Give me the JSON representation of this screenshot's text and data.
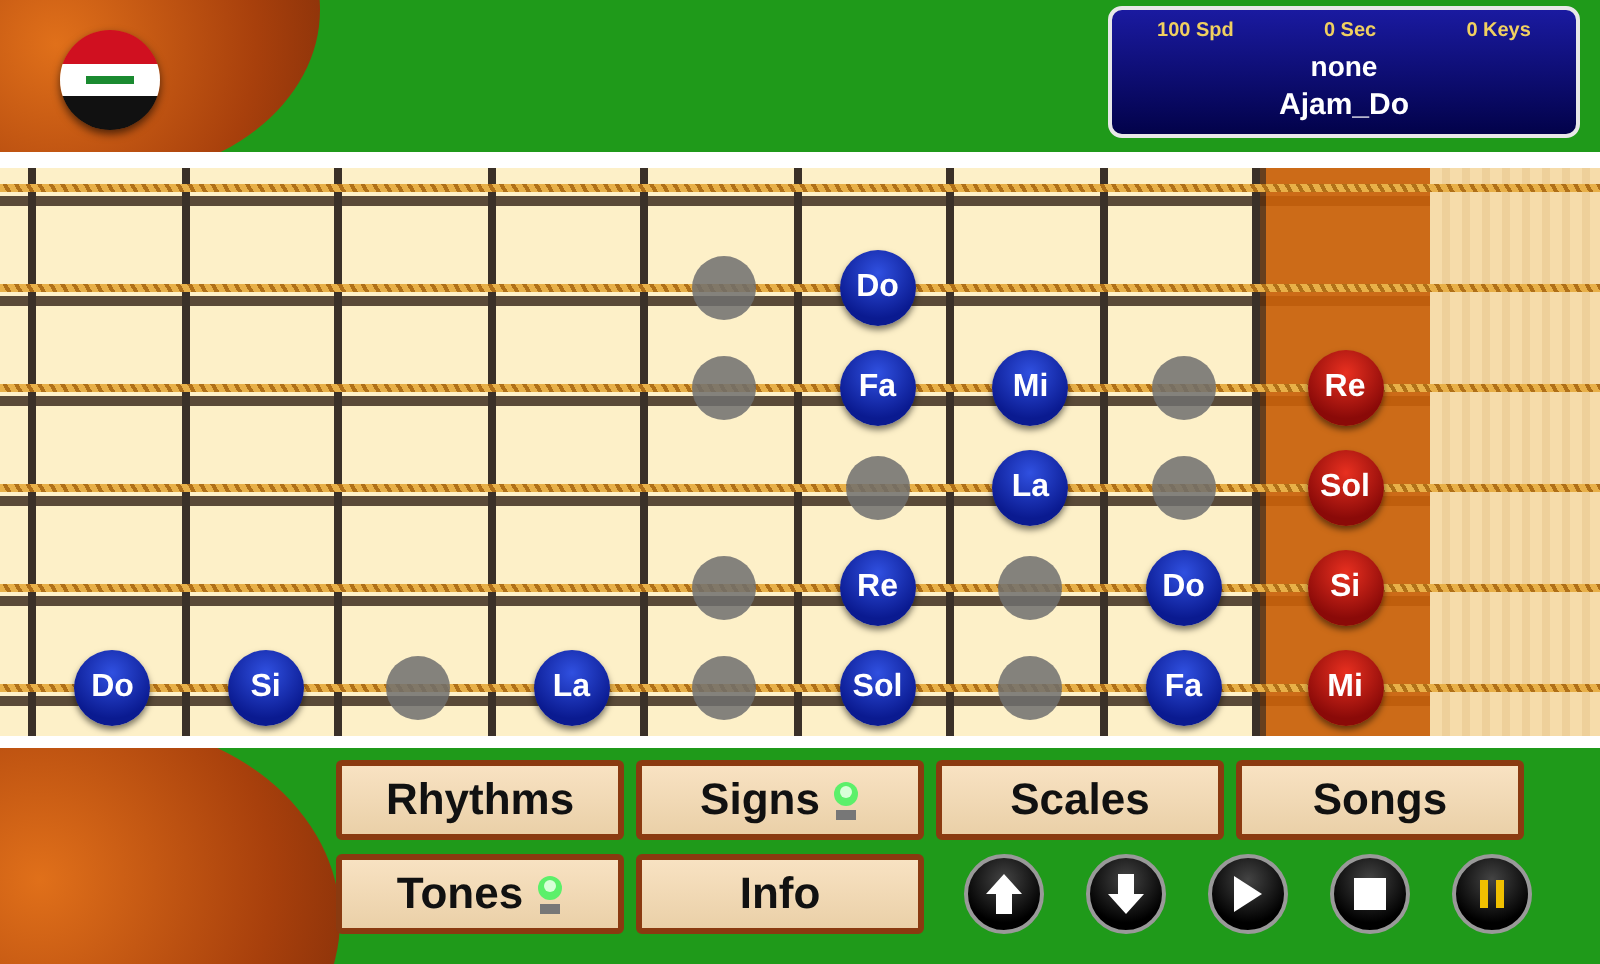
{
  "info_panel": {
    "stats": [
      "100 Spd",
      "0 Sec",
      "0 Keys"
    ],
    "status": "none",
    "scale": "Ajam_Do"
  },
  "fretboard": {
    "strings": [
      {
        "cells": [
          {
            "kind": "empty"
          },
          {
            "kind": "empty"
          },
          {
            "kind": "empty"
          },
          {
            "kind": "empty"
          },
          {
            "kind": "empty"
          },
          {
            "kind": "empty"
          },
          {
            "kind": "empty"
          },
          {
            "kind": "empty"
          },
          {
            "kind": "empty"
          }
        ]
      },
      {
        "cells": [
          {
            "kind": "empty"
          },
          {
            "kind": "empty"
          },
          {
            "kind": "empty"
          },
          {
            "kind": "empty"
          },
          {
            "kind": "dot"
          },
          {
            "kind": "note",
            "label": "Do"
          },
          {
            "kind": "empty"
          },
          {
            "kind": "empty"
          },
          {
            "kind": "empty"
          }
        ]
      },
      {
        "cells": [
          {
            "kind": "empty"
          },
          {
            "kind": "empty"
          },
          {
            "kind": "empty"
          },
          {
            "kind": "empty"
          },
          {
            "kind": "dot"
          },
          {
            "kind": "note",
            "label": "Fa"
          },
          {
            "kind": "note",
            "label": "Mi"
          },
          {
            "kind": "dot"
          },
          {
            "kind": "open",
            "label": "Re"
          }
        ]
      },
      {
        "cells": [
          {
            "kind": "empty"
          },
          {
            "kind": "empty"
          },
          {
            "kind": "empty"
          },
          {
            "kind": "empty"
          },
          {
            "kind": "empty"
          },
          {
            "kind": "dot"
          },
          {
            "kind": "note",
            "label": "La"
          },
          {
            "kind": "dot"
          },
          {
            "kind": "open",
            "label": "Sol"
          }
        ]
      },
      {
        "cells": [
          {
            "kind": "empty"
          },
          {
            "kind": "empty"
          },
          {
            "kind": "empty"
          },
          {
            "kind": "empty"
          },
          {
            "kind": "dot"
          },
          {
            "kind": "note",
            "label": "Re"
          },
          {
            "kind": "dot"
          },
          {
            "kind": "note",
            "label": "Do"
          },
          {
            "kind": "open",
            "label": "Si"
          }
        ]
      },
      {
        "cells": [
          {
            "kind": "note",
            "label": "Do"
          },
          {
            "kind": "note",
            "label": "Si"
          },
          {
            "kind": "dot"
          },
          {
            "kind": "note",
            "label": "La"
          },
          {
            "kind": "dot"
          },
          {
            "kind": "note",
            "label": "Sol"
          },
          {
            "kind": "dot"
          },
          {
            "kind": "note",
            "label": "Fa"
          },
          {
            "kind": "open",
            "label": "Mi"
          }
        ]
      }
    ]
  },
  "menu_buttons": [
    {
      "label": "Rhythms",
      "indicator": false
    },
    {
      "label": "Signs",
      "indicator": true
    },
    {
      "label": "Scales",
      "indicator": false
    },
    {
      "label": "Songs",
      "indicator": false
    },
    {
      "label": "Tones",
      "indicator": true
    },
    {
      "label": "Info",
      "indicator": false
    }
  ],
  "transport_buttons": [
    {
      "kind": "up",
      "highlighted": false
    },
    {
      "kind": "down",
      "highlighted": false
    },
    {
      "kind": "play",
      "highlighted": false
    },
    {
      "kind": "stop",
      "highlighted": false
    },
    {
      "kind": "pause",
      "highlighted": true
    }
  ]
}
